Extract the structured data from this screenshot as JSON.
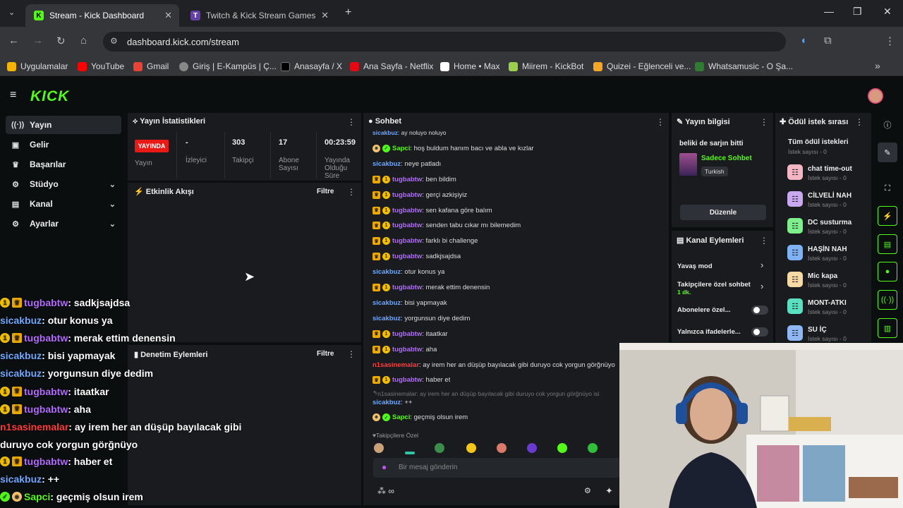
{
  "browser": {
    "tabs": [
      {
        "label": "Stream - Kick Dashboard",
        "active": true
      },
      {
        "label": "Twitch & Kick Stream Games",
        "active": false
      }
    ],
    "url": "dashboard.kick.com/stream",
    "bookmarks": [
      "Uygulamalar",
      "YouTube",
      "Gmail",
      "Giriş | E-Kampüs | Ç...",
      "Anasayfa / X",
      "Ana Sayfa - Netflix",
      "Home • Max",
      "Miirem - KickBot",
      "Quizei - Eğlenceli ve...",
      "Whatsamusic - O Şa..."
    ]
  },
  "kick": {
    "logo": "KICK"
  },
  "sidebar": {
    "items": [
      {
        "label": "Yayın",
        "icon": "broadcast-icon"
      },
      {
        "label": "Gelir",
        "icon": "wallet-icon"
      },
      {
        "label": "Başarılar",
        "icon": "trophy-icon"
      },
      {
        "label": "Stüdyo",
        "icon": "studio-icon"
      },
      {
        "label": "Kanal",
        "icon": "channel-icon"
      },
      {
        "label": "Ayarlar",
        "icon": "gear-icon"
      }
    ]
  },
  "stats": {
    "title": "Yayın İstatistikleri",
    "live": "YAYINDA",
    "cols": [
      {
        "value": "",
        "label": "Yayın"
      },
      {
        "value": "-",
        "label": "İzleyici"
      },
      {
        "value": "303",
        "label": "Takipçi"
      },
      {
        "value": "17",
        "label": "Abone Sayısı"
      },
      {
        "value": "00:23:59",
        "label": "Yayında Olduğu Süre"
      }
    ]
  },
  "activity": {
    "title": "Etkinlik Akışı",
    "filter": "Filtre"
  },
  "moderation": {
    "title": "Denetim Eylemleri",
    "filter": "Filtre"
  },
  "chat": {
    "title": "Sohbet",
    "lines": [
      {
        "user": "sicakbuz",
        "color": "blue",
        "badges": [],
        "text": ": ay noluyo noluyo"
      },
      {
        "user": "Sapci",
        "color": "green",
        "badges": [
          "face",
          "green"
        ],
        "text": ": hoş buldum hanım bacı ve abla ve kızlar"
      },
      {
        "user": "sicakbuz",
        "color": "blue",
        "badges": [],
        "text": ": neye patladı"
      },
      {
        "user": "tugbabtw",
        "color": "purple",
        "badges": [
          "crown",
          "one"
        ],
        "text": ": ben bildim"
      },
      {
        "user": "tugbabtw",
        "color": "purple",
        "badges": [
          "crown",
          "one"
        ],
        "text": ": gerçi azkişiyiz"
      },
      {
        "user": "tugbabtw",
        "color": "purple",
        "badges": [
          "crown",
          "one"
        ],
        "text": ": sen kafana göre balım"
      },
      {
        "user": "tugbabtw",
        "color": "purple",
        "badges": [
          "crown",
          "one"
        ],
        "text": ": senden tabu cıkar mı bilemedim"
      },
      {
        "user": "tugbabtw",
        "color": "purple",
        "badges": [
          "crown",
          "one"
        ],
        "text": ": farklı bi challenge"
      },
      {
        "user": "tugbabtw",
        "color": "purple",
        "badges": [
          "crown",
          "one"
        ],
        "text": ": sadkjsajdsa"
      },
      {
        "user": "sicakbuz",
        "color": "blue",
        "badges": [],
        "text": ": otur konus ya"
      },
      {
        "user": "tugbabtw",
        "color": "purple",
        "badges": [
          "crown",
          "one"
        ],
        "text": ": merak ettim denensin"
      },
      {
        "user": "sicakbuz",
        "color": "blue",
        "badges": [],
        "text": ": bisi yapmayak"
      },
      {
        "user": "sicakbuz",
        "color": "blue",
        "badges": [],
        "text": ": yorgunsun diye dedim"
      },
      {
        "user": "tugbabtw",
        "color": "purple",
        "badges": [
          "crown",
          "one"
        ],
        "text": ": itaatkar"
      },
      {
        "user": "tugbabtw",
        "color": "purple",
        "badges": [
          "crown",
          "one"
        ],
        "text": ": aha"
      },
      {
        "user": "n1sasinemalar",
        "color": "red",
        "badges": [],
        "text": ": ay irem her an düşüp bayılacak gibi duruyo cok yorgun görğnüyo"
      },
      {
        "user": "tugbabtw",
        "color": "purple",
        "badges": [
          "crown",
          "one"
        ],
        "text": ": haber et"
      }
    ],
    "reply": "n1sasinemalar: ay irem her an düşüp bayılacak gibi duruyo cok yorgun görğnüyo isi",
    "lines2": [
      {
        "user": "sicakbuz",
        "color": "blue",
        "badges": [],
        "text": ": ++"
      },
      {
        "user": "Sapci",
        "color": "green",
        "badges": [
          "face",
          "green"
        ],
        "text": ": geçmiş olsun irem"
      }
    ],
    "followers_only": "Takipçilere Özel",
    "input_placeholder": "Bir mesaj gönderin"
  },
  "overlay": [
    {
      "user": "tugbabtw",
      "color": "purple",
      "badges": [
        "one",
        "crown"
      ],
      "text": " : sadkjsajdsa"
    },
    {
      "user": "sicakbuz",
      "color": "blue",
      "badges": [],
      "text": " : otur konus ya"
    },
    {
      "user": "tugbabtw",
      "color": "purple",
      "badges": [
        "one",
        "crown"
      ],
      "text": " : merak ettim denensin"
    },
    {
      "user": "sicakbuz",
      "color": "blue",
      "badges": [],
      "text": " : bisi yapmayak"
    },
    {
      "user": "sicakbuz",
      "color": "blue",
      "badges": [],
      "text": " : yorgunsun diye dedim"
    },
    {
      "user": "tugbabtw",
      "color": "purple",
      "badges": [
        "one",
        "crown"
      ],
      "text": " : itaatkar"
    },
    {
      "user": "tugbabtw",
      "color": "purple",
      "badges": [
        "one",
        "crown"
      ],
      "text": " : aha"
    },
    {
      "user": "n1sasinemalar",
      "color": "red",
      "badges": [],
      "text": " : ay irem her an düşüp bayılacak gibi"
    },
    {
      "user": "",
      "color": "none",
      "badges": [],
      "text": "duruyo cok yorgun görğnüyo"
    },
    {
      "user": "tugbabtw",
      "color": "purple",
      "badges": [
        "one",
        "crown"
      ],
      "text": " : haber et"
    },
    {
      "user": "sicakbuz",
      "color": "blue",
      "badges": [],
      "text": " : ++"
    },
    {
      "user": "Sapci",
      "color": "green",
      "badges": [
        "green",
        "face"
      ],
      "text": " : geçmiş olsun irem"
    }
  ],
  "stream_info": {
    "title": "Yayın bilgisi",
    "stream_title": "beliki de sarjın bitti",
    "category": "Sadece Sohbet",
    "language": "Turkish",
    "edit": "Düzenle"
  },
  "channel_actions": {
    "title": "Kanal Eylemleri",
    "items": [
      {
        "label": "Yavaş mod",
        "sub": ""
      },
      {
        "label": "Takipçilere özel sohbet",
        "sub": "1 dk."
      },
      {
        "label": "Abonelere özel...",
        "sub": ""
      },
      {
        "label": "Yalnızca ifadelerle...",
        "sub": ""
      }
    ]
  },
  "rewards": {
    "title": "Ödül istek sırası",
    "all": "Tüm ödül istekleri",
    "all_count": "İstek sayısı - 0",
    "items": [
      {
        "name": "chat time-out",
        "count": "İstek sayısı - 0",
        "color": "#f4b6c2"
      },
      {
        "name": "CİLVELİ NAH",
        "count": "İstek sayısı - 0",
        "color": "#c9a8f0"
      },
      {
        "name": "DC susturma",
        "count": "İstek sayısı - 0",
        "color": "#7cf08a"
      },
      {
        "name": "HAŞİN NAH",
        "count": "İstek sayısı - 0",
        "color": "#7fb2f5"
      },
      {
        "name": "Mic kapa",
        "count": "İstek sayısı - 0",
        "color": "#f6d9a4"
      },
      {
        "name": "MONT-ATKI",
        "count": "İstek sayısı - 0",
        "color": "#58e0c0"
      },
      {
        "name": "SU İÇ",
        "count": "İstek sayısı - 0",
        "color": "#8fb6f5"
      }
    ]
  }
}
